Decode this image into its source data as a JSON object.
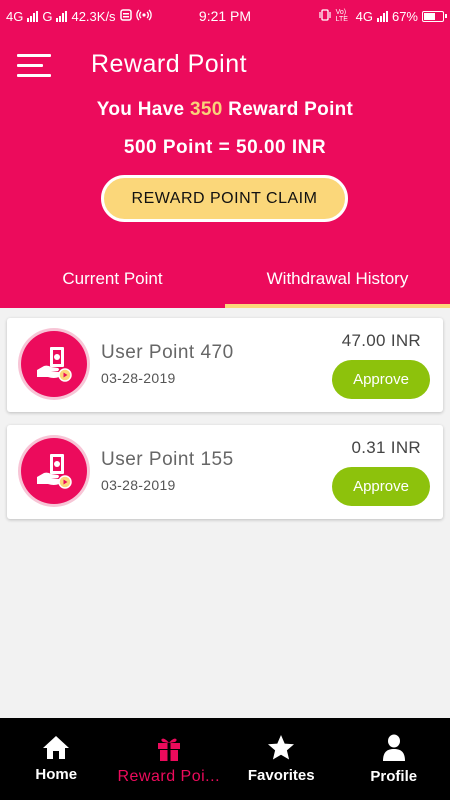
{
  "status_bar": {
    "net1": "4G",
    "net2": "G",
    "speed": "42.3K/s",
    "time": "9:21 PM",
    "lte": "Vo) LTE",
    "net3": "4G",
    "battery": "67%",
    "battery_level": 0.67
  },
  "header": {
    "title": "Reward Point",
    "have_prefix": "You Have",
    "points": "350",
    "have_suffix": "Reward Point",
    "rate": "500 Point = 50.00 INR",
    "claim_button": "REWARD POINT CLAIM"
  },
  "tabs": [
    {
      "label": "Current Point",
      "active": false
    },
    {
      "label": "Withdrawal History",
      "active": true
    }
  ],
  "history": [
    {
      "title": "User Point 470",
      "date": "03-28-2019",
      "amount": "47.00 INR",
      "action": "Approve"
    },
    {
      "title": "User Point 155",
      "date": "03-28-2019",
      "amount": "0.31 INR",
      "action": "Approve"
    }
  ],
  "bottom_nav": [
    {
      "label": "Home",
      "icon": "home-icon",
      "active": false
    },
    {
      "label": "Reward Poi...",
      "icon": "gift-icon",
      "active": true
    },
    {
      "label": "Favorites",
      "icon": "star-icon",
      "active": false
    },
    {
      "label": "Profile",
      "icon": "person-icon",
      "active": false
    }
  ],
  "colors": {
    "primary": "#ec0b5c",
    "accent": "#fbd77a",
    "approve": "#8dc20c",
    "nav_bg": "#000000"
  }
}
